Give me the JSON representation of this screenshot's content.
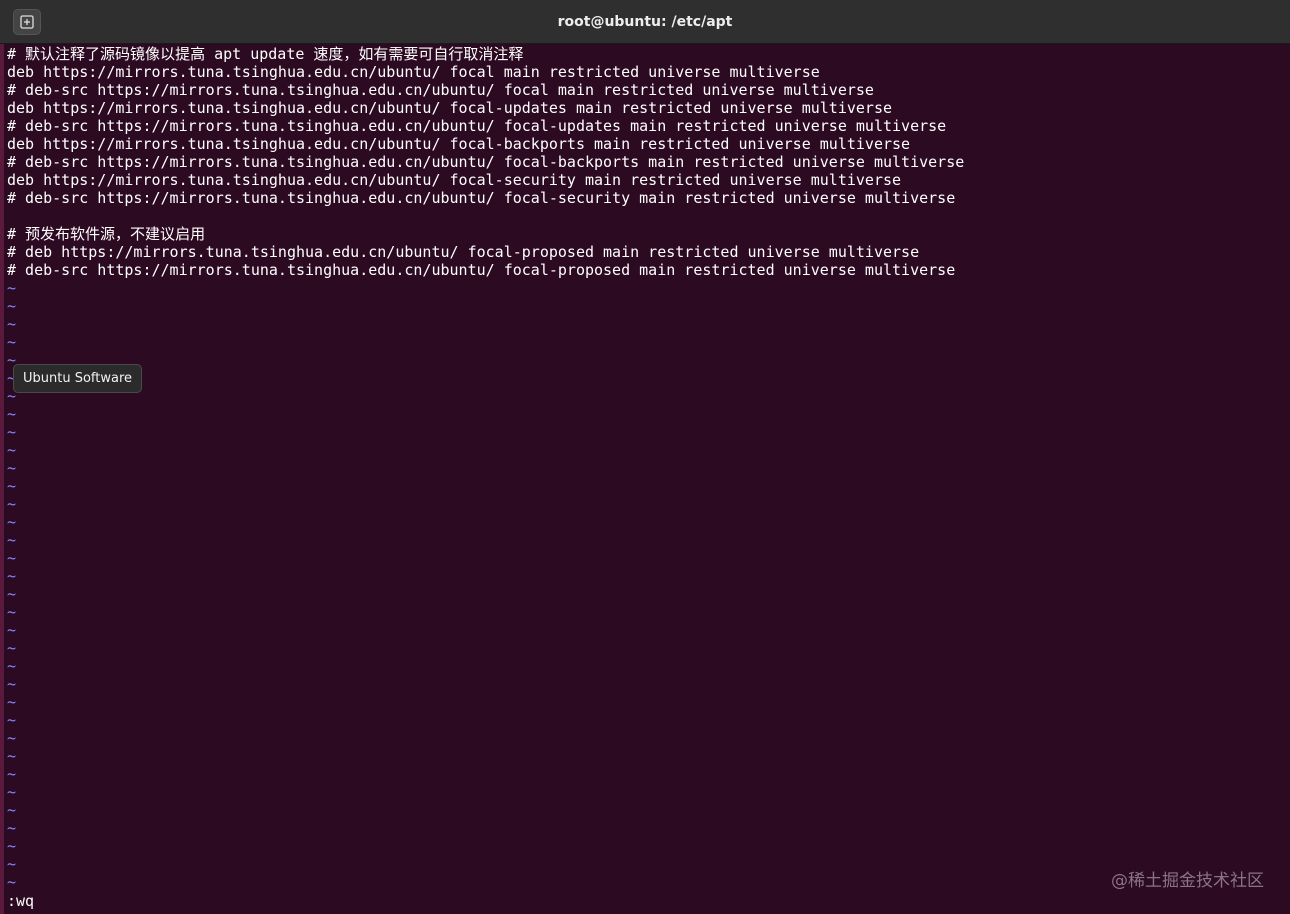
{
  "window": {
    "title": "root@ubuntu: /etc/apt",
    "new_tab_icon": "new-tab-icon"
  },
  "editor": {
    "lines": [
      "# 默认注释了源码镜像以提高 apt update 速度，如有需要可自行取消注释",
      "deb https://mirrors.tuna.tsinghua.edu.cn/ubuntu/ focal main restricted universe multiverse",
      "# deb-src https://mirrors.tuna.tsinghua.edu.cn/ubuntu/ focal main restricted universe multiverse",
      "deb https://mirrors.tuna.tsinghua.edu.cn/ubuntu/ focal-updates main restricted universe multiverse",
      "# deb-src https://mirrors.tuna.tsinghua.edu.cn/ubuntu/ focal-updates main restricted universe multiverse",
      "deb https://mirrors.tuna.tsinghua.edu.cn/ubuntu/ focal-backports main restricted universe multiverse",
      "# deb-src https://mirrors.tuna.tsinghua.edu.cn/ubuntu/ focal-backports main restricted universe multiverse",
      "deb https://mirrors.tuna.tsinghua.edu.cn/ubuntu/ focal-security main restricted universe multiverse",
      "# deb-src https://mirrors.tuna.tsinghua.edu.cn/ubuntu/ focal-security main restricted universe multiverse",
      "",
      "# 预发布软件源，不建议启用",
      "# deb https://mirrors.tuna.tsinghua.edu.cn/ubuntu/ focal-proposed main restricted universe multiverse",
      "# deb-src https://mirrors.tuna.tsinghua.edu.cn/ubuntu/ focal-proposed main restricted universe multiverse"
    ],
    "empty_line_marker": "~",
    "empty_line_count": 34,
    "command_line": ":wq"
  },
  "tooltip": {
    "text": "Ubuntu Software"
  },
  "watermark": {
    "text": "@稀土掘金技术社区"
  },
  "colors": {
    "background": "#2c0a22",
    "titlebar": "#2f2f2f",
    "text": "#ffffff",
    "tilde": "#8787ff"
  }
}
